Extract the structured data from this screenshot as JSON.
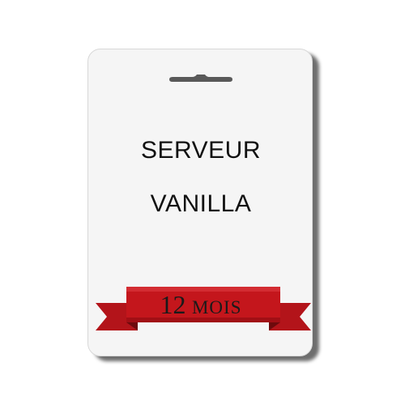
{
  "card": {
    "line1": "SERVEUR",
    "line2": "VANILLA"
  },
  "ribbon": {
    "number": "12",
    "unit": "MOIS"
  },
  "colors": {
    "ribbon": "#c4161c",
    "ribbon_dark": "#8a0c10",
    "card": "#f5f5f5"
  },
  "icons": {
    "hang_slot": "hang-slot-icon"
  }
}
